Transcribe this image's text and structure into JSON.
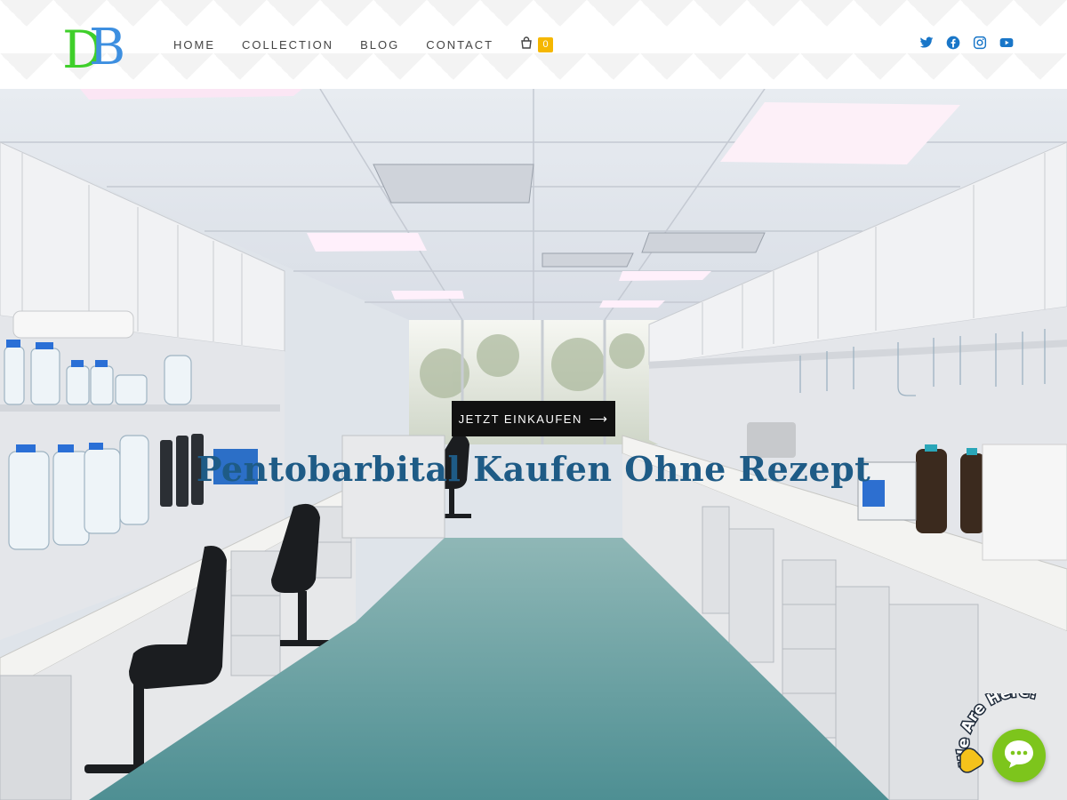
{
  "site": {
    "logo_text": "DB"
  },
  "nav": {
    "items": [
      "HOME",
      "COLLECTION",
      "BLOG",
      "CONTACT"
    ],
    "cart_count": "0"
  },
  "social": [
    "twitter-icon",
    "facebook-icon",
    "instagram-icon",
    "youtube-icon"
  ],
  "hero": {
    "cta_label": "JETZT EINKAUFEN",
    "title": "Pentobarbital Kaufen Ohne Rezept"
  },
  "chat": {
    "label": "We Are Here!"
  },
  "colors": {
    "accent": "#f5b700",
    "brand_green": "#3fcf2a",
    "brand_blue": "#3d8fe0",
    "title_blue": "#1e5b86",
    "social_blue": "#1976c8",
    "chat_green": "#7dc51c"
  }
}
